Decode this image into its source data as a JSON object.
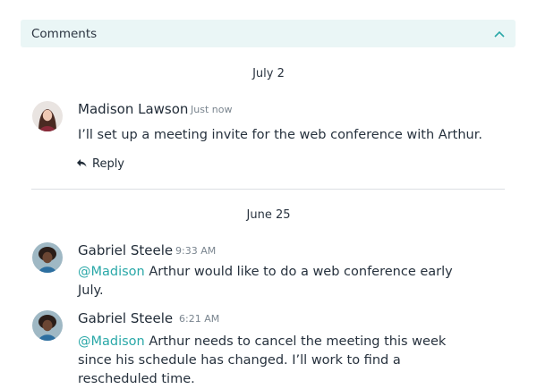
{
  "panel": {
    "title": "Comments",
    "toggle_icon": "chevron-up-icon",
    "accent": "#2aa8a8",
    "header_bg": "#eaf6f6"
  },
  "groups": [
    {
      "date": "July 2",
      "comments": [
        {
          "author": "Madison Lawson",
          "time": "Just now",
          "text": "I’ll set up a meeting invite for the web conference with Arthur.",
          "reply_label": "Reply",
          "reply_icon": "reply-arrow-icon"
        }
      ]
    },
    {
      "date": "June 25",
      "comments": [
        {
          "author": "Gabriel Steele",
          "time": "9:33 AM",
          "mention": "@Madison",
          "text": " Arthur would like to do a web conference early July."
        },
        {
          "author": "Gabriel Steele",
          "time": "6:21 AM",
          "mention": "@Madison",
          "text": " Arthur needs to cancel the meeting this week since his schedule has changed. I’ll work to find a rescheduled time."
        }
      ]
    }
  ]
}
